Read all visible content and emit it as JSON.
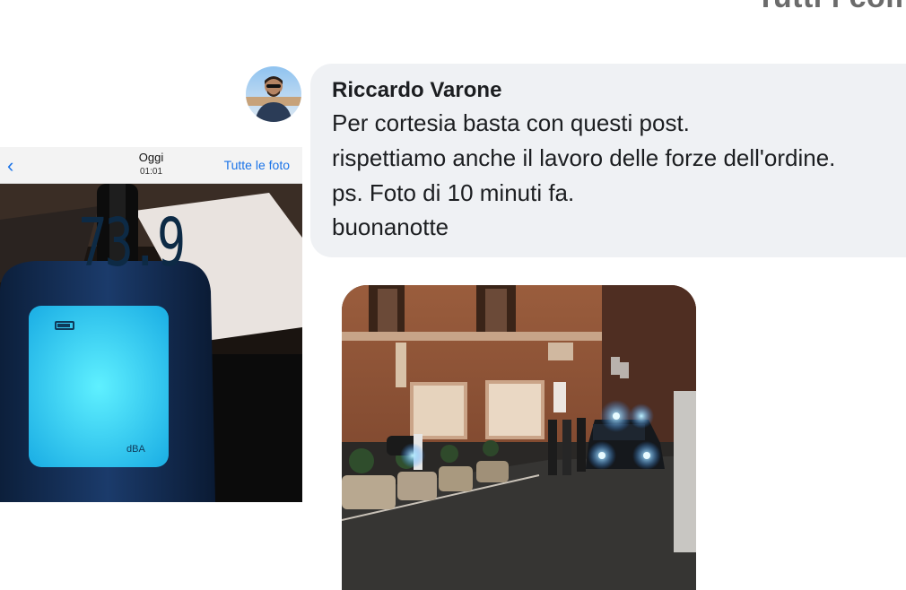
{
  "corner_text": "Tutti i com",
  "comment": {
    "author": "Riccardo Varone",
    "lines": [
      "Per cortesia basta con questi post.",
      "rispettiamo anche il lavoro delle forze dell'ordine.",
      "ps. Foto di 10 minuti fa.",
      "buonanotte"
    ]
  },
  "phone_photo": {
    "header_title": "Oggi",
    "header_time": "01:01",
    "all_photos_label": "Tutte le foto",
    "meter_reading": "73.9",
    "meter_unit": "dBA"
  },
  "colors": {
    "bubble_bg": "#eff1f4",
    "link_blue": "#1a73e8",
    "display_cyan": "#3fe3ff",
    "police_light": "#5fd0ff"
  }
}
